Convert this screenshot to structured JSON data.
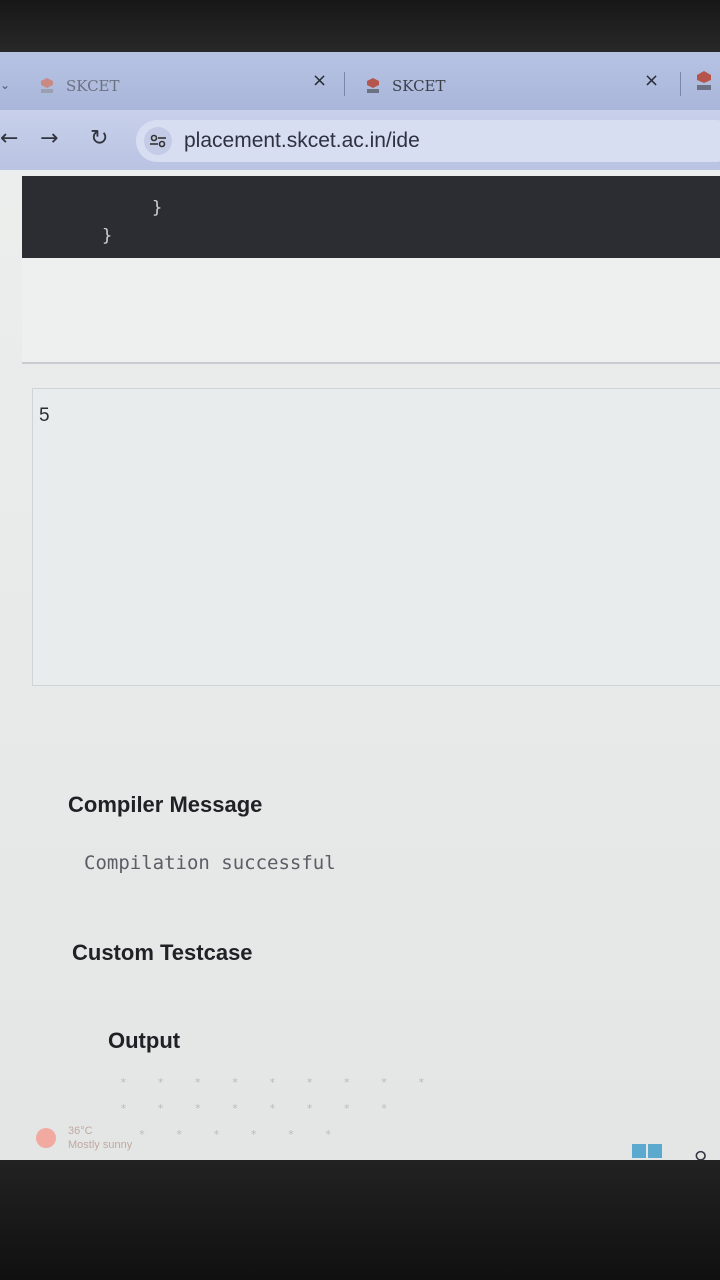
{
  "browser": {
    "tabs": [
      {
        "title": "SKCET",
        "close": "×"
      },
      {
        "title": "SKCET",
        "close": "×"
      }
    ],
    "url": "placement.skcet.ac.in/ide"
  },
  "editor": {
    "code_lines": [
      "}",
      "}"
    ]
  },
  "io": {
    "value": "5"
  },
  "compiler": {
    "heading": "Compiler Message",
    "message": "Compilation successful"
  },
  "testcase": {
    "heading": "Custom Testcase"
  },
  "output": {
    "heading": "Output"
  },
  "taskbar": {
    "temperature": "36°C",
    "condition": "Mostly sunny"
  },
  "colors": {
    "tab_strip": "#b7c3e3",
    "editor_bg": "#2b2d33",
    "page_bg": "#e6e9e8"
  }
}
